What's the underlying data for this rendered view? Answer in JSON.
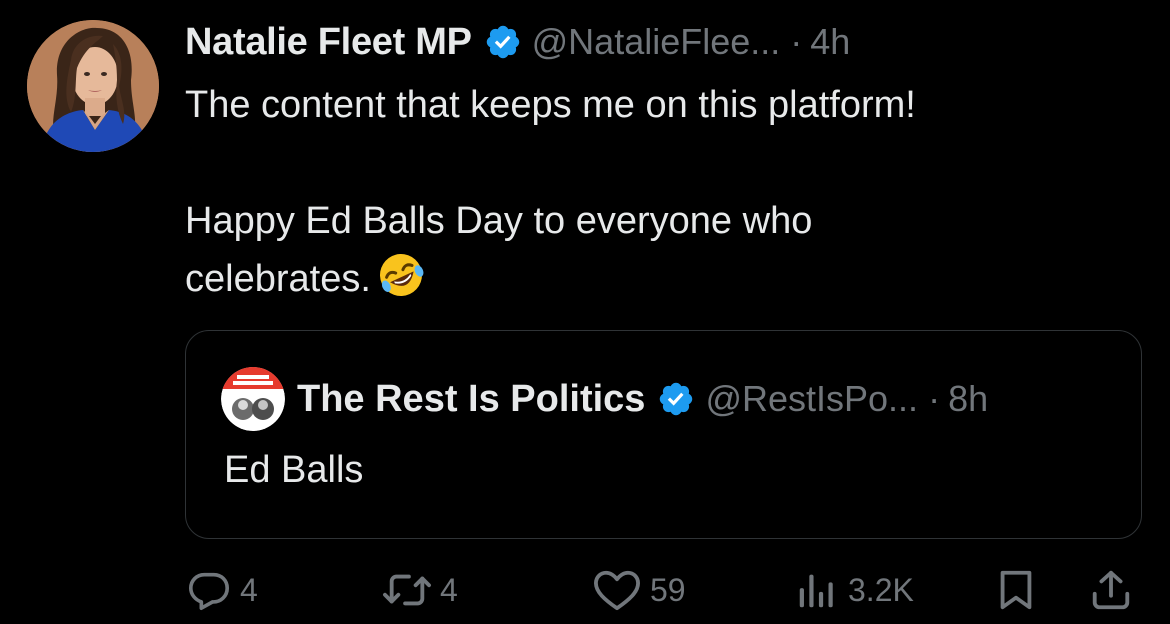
{
  "tweet": {
    "author": {
      "name": "Natalie Fleet MP",
      "handle": "@NatalieFlee...",
      "verified": true
    },
    "separator": "·",
    "time": "4h",
    "lines": [
      "The content that keeps me on this platform!",
      "Happy Ed Balls Day to everyone who",
      "celebrates."
    ],
    "emoji": "rolling-on-the-floor-laughing"
  },
  "quote": {
    "name": "The Rest Is Politics",
    "handle": "@RestIsPo...",
    "separator": "·",
    "time": "8h",
    "text": "Ed Balls",
    "avatar_lettering": "The Rest Is Politics"
  },
  "actions": {
    "replies": "4",
    "retweets": "4",
    "likes": "59",
    "views": "3.2K"
  },
  "colors": {
    "background": "#000000",
    "text": "#e7e9ea",
    "muted": "#71767b",
    "verified": "#1d9bf0",
    "border": "#2f3336"
  },
  "icons": [
    "verified-badge-icon",
    "reply-icon",
    "retweet-icon",
    "like-icon",
    "views-icon",
    "bookmark-icon",
    "share-icon"
  ]
}
